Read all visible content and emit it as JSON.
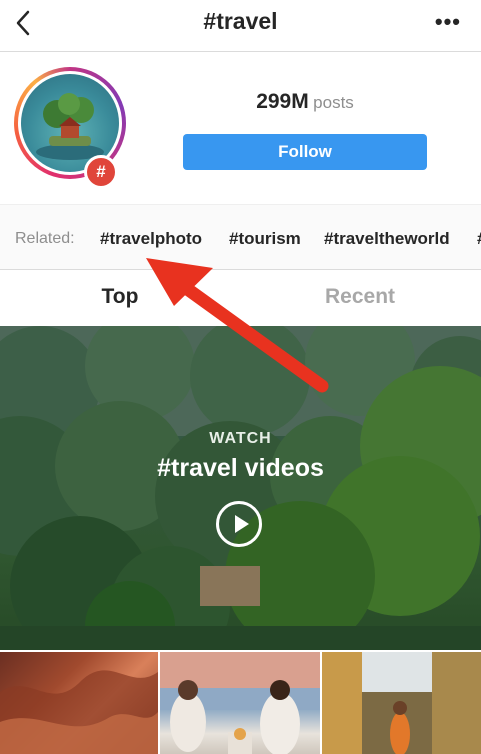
{
  "header": {
    "title": "#travel",
    "more_label": "•••"
  },
  "profile": {
    "hashtag_badge": "#",
    "post_count": "299M",
    "post_label": "posts",
    "follow_label": "Follow"
  },
  "related": {
    "label": "Related:",
    "tags": [
      "#travelphoto",
      "#tourism",
      "#traveltheworld",
      "#"
    ]
  },
  "tabs": {
    "top": "Top",
    "recent": "Recent"
  },
  "hero": {
    "eyebrow": "WATCH",
    "title": "#travel videos"
  },
  "colors": {
    "accent_blue": "#3897f0",
    "annotation_red": "#e8321f",
    "hashtag_badge": "#e0453a"
  },
  "icons": [
    "back-chevron-icon",
    "more-icon",
    "play-icon",
    "hashtag-icon"
  ]
}
